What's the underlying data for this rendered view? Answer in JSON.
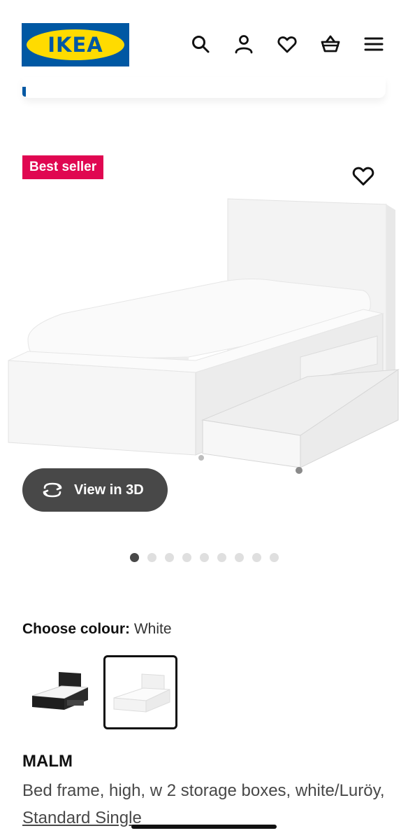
{
  "header": {
    "logo_text": "IKEA",
    "icons": [
      "search-icon",
      "account-icon",
      "heart-icon",
      "basket-icon",
      "menu-icon"
    ]
  },
  "badge": {
    "label": "Best seller",
    "color": "#e00751"
  },
  "gallery": {
    "view3d_label": "View in 3D",
    "dots_total": 9,
    "active_dot": 1
  },
  "colour": {
    "label": "Choose colour:",
    "value": "White",
    "options": [
      "black-brown",
      "white"
    ],
    "selected": "white"
  },
  "product": {
    "name": "MALM",
    "desc_prefix": "Bed frame, high, w 2 storage boxes, white/Luröy, ",
    "size_link": "Standard Single"
  },
  "colors": {
    "brand_blue": "#0058a3",
    "brand_yellow": "#ffdb00",
    "button_dark": "#484848"
  }
}
